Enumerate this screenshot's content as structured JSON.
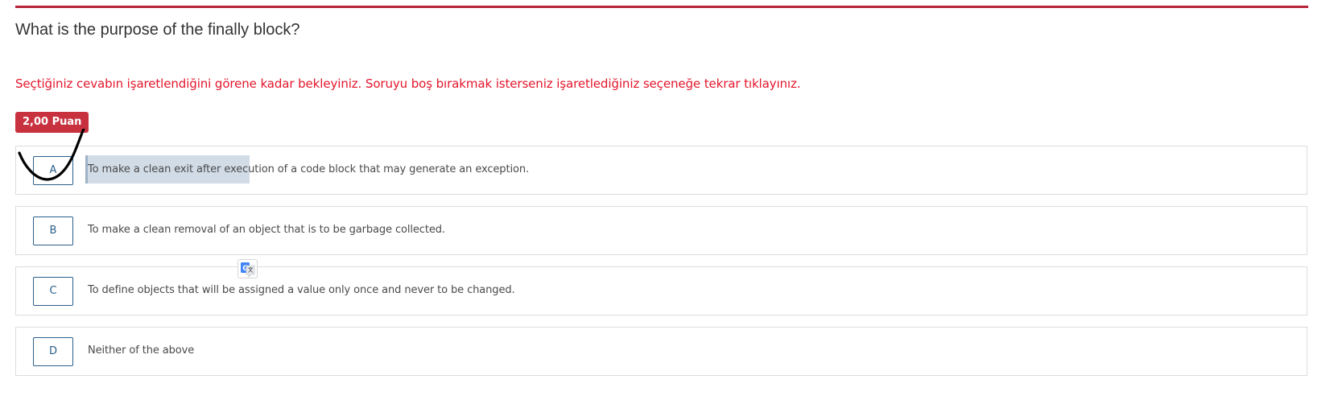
{
  "question": {
    "title": "What is the purpose of the finally block?",
    "instruction": "Seçtiğiniz cevabın işaretlendiğini görene kadar bekleyiniz. Soruyu boş bırakmak isterseniz işaretlediğiniz seçeneğe tekrar tıklayınız.",
    "points_label": "2,00 Puan"
  },
  "options": [
    {
      "letter": "A",
      "text": "To make a clean exit after execution of a code block that may generate an exception.",
      "selected": true
    },
    {
      "letter": "B",
      "text": "To make a clean removal of an object that is to be garbage collected.",
      "selected": false
    },
    {
      "letter": "C",
      "text": "To define objects that will be assigned a value only once and never to be changed.",
      "selected": false
    },
    {
      "letter": "D",
      "text": "Neither of the above",
      "selected": false
    }
  ],
  "icons": {
    "translate": "google-translate-icon",
    "annotation": "hand-drawn-checkmark"
  },
  "colors": {
    "accent_red": "#b8243a",
    "instruction_red": "#e3162b",
    "badge_red": "#c8323f",
    "option_border_blue": "#2b5f8a"
  }
}
